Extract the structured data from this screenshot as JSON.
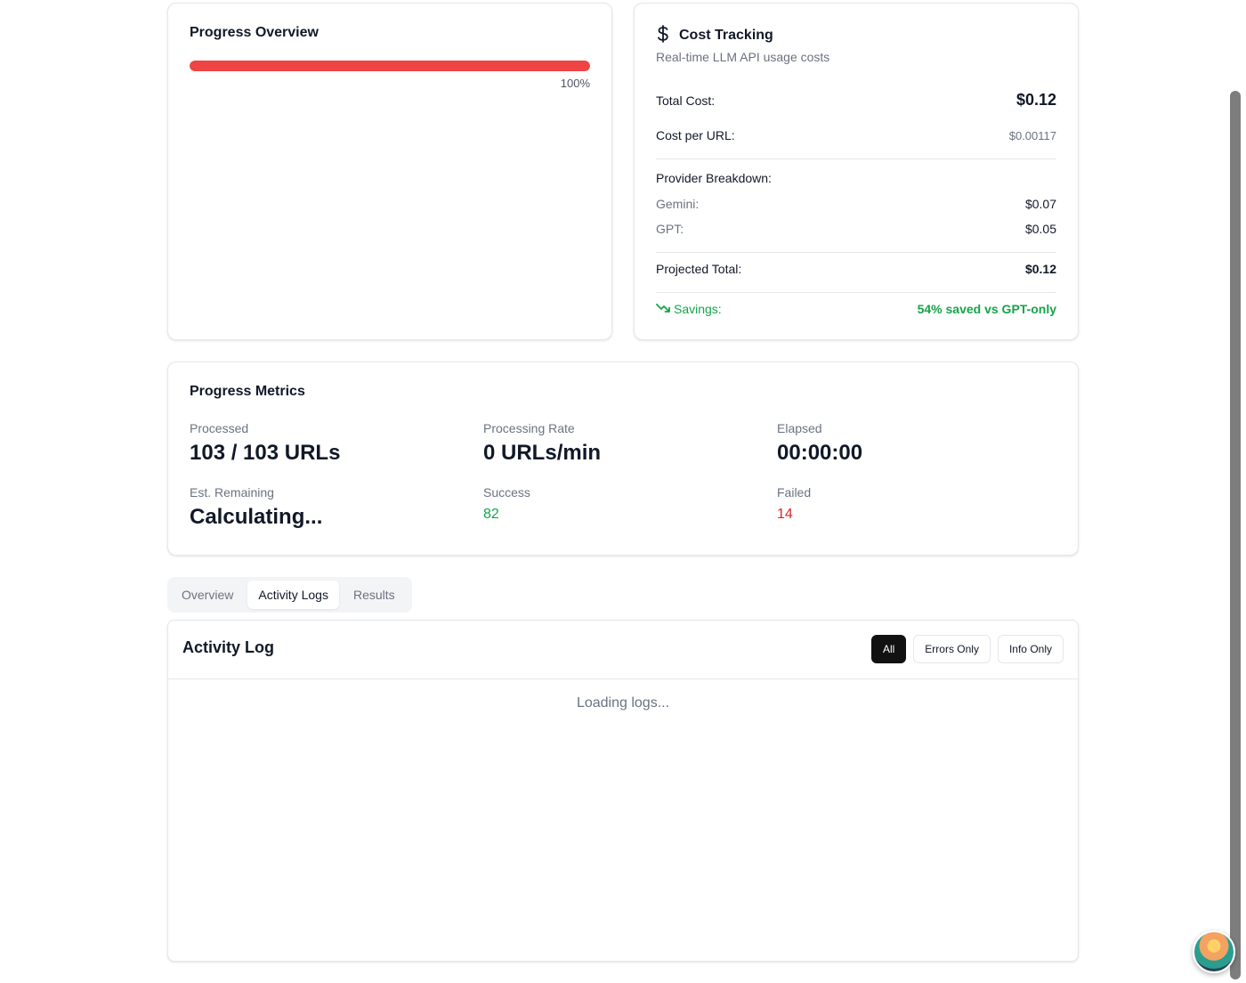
{
  "progress_overview": {
    "title": "Progress Overview",
    "percent_label": "100%",
    "percent_value": 1.0,
    "bar_color": "#ef4444"
  },
  "cost_tracking": {
    "icon": "dollar-icon",
    "title": "Cost Tracking",
    "subtitle": "Real-time LLM API usage costs",
    "total_cost_label": "Total Cost:",
    "total_cost_value": "$0.12",
    "cost_per_url_label": "Cost per URL:",
    "cost_per_url_value": "$0.00117",
    "provider_breakdown_label": "Provider Breakdown:",
    "providers": [
      {
        "name": "Gemini:",
        "value": "$0.07"
      },
      {
        "name": "GPT:",
        "value": "$0.05"
      }
    ],
    "projected_total_label": "Projected Total:",
    "projected_total_value": "$0.12",
    "savings_icon": "trending-down-icon",
    "savings_label": "Savings:",
    "savings_value": "54% saved vs GPT-only",
    "savings_color": "#16a34a"
  },
  "progress_metrics": {
    "title": "Progress Metrics",
    "processed_label": "Processed",
    "processed_value": "103 / 103 URLs",
    "rate_label": "Processing Rate",
    "rate_value": "0 URLs/min",
    "elapsed_label": "Elapsed",
    "elapsed_value": "00:00:00",
    "remaining_label": "Est. Remaining",
    "remaining_value": "Calculating...",
    "success_label": "Success",
    "success_value": "82",
    "failed_label": "Failed",
    "failed_value": "14"
  },
  "tabs": [
    {
      "label": "Overview",
      "active": false
    },
    {
      "label": "Activity Logs",
      "active": true
    },
    {
      "label": "Results",
      "active": false
    }
  ],
  "activity_log": {
    "title": "Activity Log",
    "filters": [
      {
        "label": "All",
        "active": true
      },
      {
        "label": "Errors Only",
        "active": false
      },
      {
        "label": "Info Only",
        "active": false
      }
    ],
    "loading_text": "Loading logs..."
  }
}
